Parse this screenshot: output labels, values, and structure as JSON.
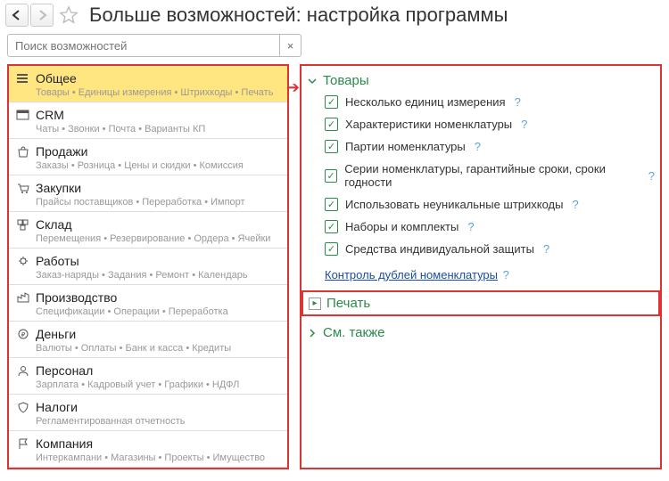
{
  "header": {
    "title": "Больше возможностей: настройка программы"
  },
  "search": {
    "placeholder": "Поиск возможностей",
    "clear": "×"
  },
  "categories": [
    {
      "id": "general",
      "label": "Общее",
      "sub": "Товары • Единицы измерения • Штрихкоды • Печать",
      "icon": "list",
      "active": true
    },
    {
      "id": "crm",
      "label": "CRM",
      "sub": "Чаты • Звонки • Почта • Варианты КП",
      "icon": "card"
    },
    {
      "id": "sales",
      "label": "Продажи",
      "sub": "Заказы • Розница • Цены и скидки • Комиссия",
      "icon": "bag"
    },
    {
      "id": "purchases",
      "label": "Закупки",
      "sub": "Прайсы поставщиков • Переработка • Импорт",
      "icon": "cart"
    },
    {
      "id": "warehouse",
      "label": "Склад",
      "sub": "Перемещения • Резервирование • Ордера • Ячейки",
      "icon": "boxes"
    },
    {
      "id": "works",
      "label": "Работы",
      "sub": "Заказ-наряды • Задания • Ремонт • Календарь",
      "icon": "gear"
    },
    {
      "id": "production",
      "label": "Производство",
      "sub": "Спецификации • Операции • Переработка",
      "icon": "factory"
    },
    {
      "id": "money",
      "label": "Деньги",
      "sub": "Валюты • Оплаты • Банк и касса • Кредиты",
      "icon": "coin"
    },
    {
      "id": "personnel",
      "label": "Персонал",
      "sub": "Зарплата • Кадровый учет • Графики • НДФЛ",
      "icon": "person"
    },
    {
      "id": "taxes",
      "label": "Налоги",
      "sub": "Регламентированная отчетность",
      "icon": "shield"
    },
    {
      "id": "company",
      "label": "Компания",
      "sub": "Интеркампани • Магазины • Проекты • Имущество",
      "icon": "flag"
    }
  ],
  "sections": {
    "goods": {
      "title": "Товары",
      "checks": [
        {
          "label": "Несколько единиц измерения",
          "checked": true
        },
        {
          "label": "Характеристики номенклатуры",
          "checked": true
        },
        {
          "label": "Партии номенклатуры",
          "checked": true
        },
        {
          "label": "Серии номенклатуры, гарантийные сроки, сроки годности",
          "checked": true
        },
        {
          "label": "Использовать неуникальные штрихкоды",
          "checked": true
        },
        {
          "label": "Наборы и комплекты",
          "checked": true
        },
        {
          "label": "Средства индивидуальной защиты",
          "checked": true
        }
      ],
      "link": "Контроль дублей номенклатуры"
    },
    "print": {
      "title": "Печать"
    },
    "seealso": {
      "title": "См. также"
    }
  },
  "help": "?"
}
